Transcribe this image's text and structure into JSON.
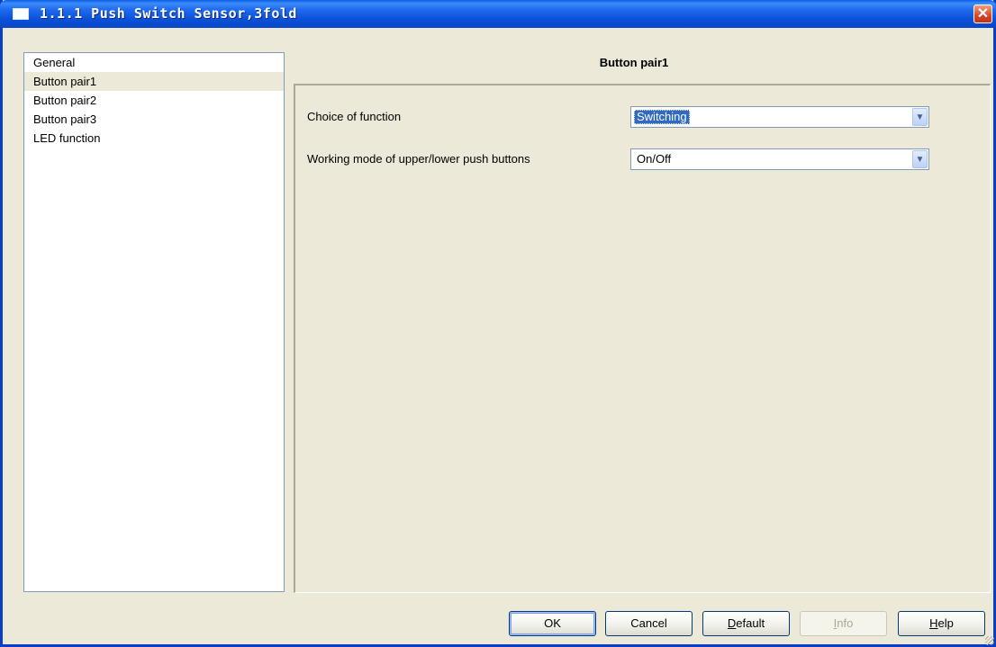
{
  "window": {
    "title": "1.1.1 Push Switch Sensor,3fold",
    "close_symbol": "✕"
  },
  "nav": {
    "items": [
      {
        "label": "General",
        "selected": false
      },
      {
        "label": "Button pair1",
        "selected": true
      },
      {
        "label": "Button pair2",
        "selected": false
      },
      {
        "label": "Button pair3",
        "selected": false
      },
      {
        "label": "LED function",
        "selected": false
      }
    ]
  },
  "panel": {
    "title": "Button pair1",
    "params": [
      {
        "label": "Choice of function",
        "value": "Switching",
        "focused": true
      },
      {
        "label": "Working mode of upper/lower push buttons",
        "value": "On/Off",
        "focused": false
      }
    ]
  },
  "buttons": {
    "ok": {
      "label": "OK"
    },
    "cancel": {
      "label": "Cancel"
    },
    "default": {
      "label": "Default",
      "mnemonic": "D",
      "rest": "efault"
    },
    "info": {
      "label": "Info",
      "mnemonic": "I",
      "rest": "nfo",
      "enabled": false
    },
    "help": {
      "label": "Help",
      "mnemonic": "H",
      "rest": "elp"
    }
  },
  "icons": {
    "dropdown_arrow": "chevron-down-icon",
    "close": "close-icon",
    "app": "window-icon"
  },
  "colors": {
    "titlebar": "#0A5EE8",
    "dialog_bg": "#ECE9D8",
    "selection": "#316AC5",
    "close": "#D7452A"
  }
}
